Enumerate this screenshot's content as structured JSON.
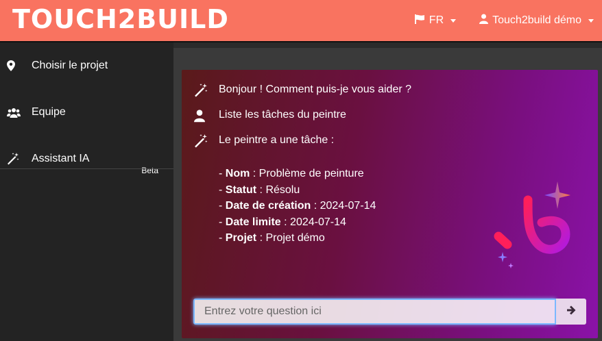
{
  "header": {
    "logo_text": "TOUCH2BUILD",
    "language_label": "FR",
    "user_label": "Touch2build démo"
  },
  "sidebar": {
    "items": [
      {
        "label": "Choisir le projet",
        "icon": "map-marker-icon"
      },
      {
        "label": "Equipe",
        "icon": "users-icon"
      },
      {
        "label": "Assistant IA",
        "icon": "magic-wand-icon",
        "badge": "Beta"
      }
    ]
  },
  "chat": {
    "messages": [
      {
        "role": "assistant",
        "text": "Bonjour ! Comment puis-je vous aider ?"
      },
      {
        "role": "user",
        "text": "Liste les tâches du peintre"
      },
      {
        "role": "assistant",
        "text": "Le peintre a une tâche :"
      }
    ],
    "task": {
      "nom_label": "Nom",
      "nom_value": " : Problème de peinture",
      "statut_label": "Statut",
      "statut_value": " : Résolu",
      "creation_label": "Date de création",
      "creation_value": " : 2024-07-14",
      "limite_label": "Date limite",
      "limite_value": " : 2024-07-14",
      "projet_label": "Projet",
      "projet_value": " : Projet démo"
    },
    "input_placeholder": "Entrez votre question ici"
  },
  "colors": {
    "header_bg": "#f97360",
    "sidebar_bg": "#232323",
    "panel_gradient_start": "#5a1a1a",
    "panel_gradient_end": "#8a12a8"
  }
}
